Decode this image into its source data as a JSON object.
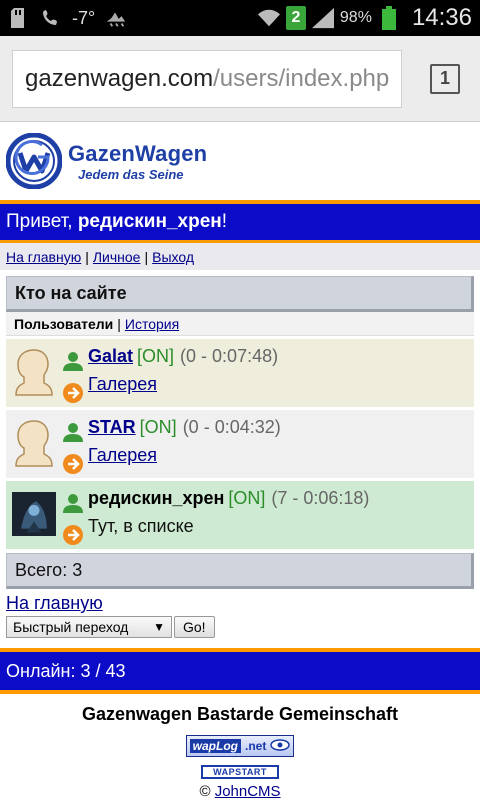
{
  "statusbar": {
    "temperature": "-7°",
    "notification_count": "2",
    "battery_percent": "98%",
    "time": "14:36"
  },
  "browser": {
    "url_host": "gazenwagen.com",
    "url_path": "/users/index.php",
    "tab_count": "1"
  },
  "site": {
    "name": "GazenWagen",
    "tagline": "Jedem das Seine"
  },
  "greeting": {
    "prefix": "Привет, ",
    "username": "редискин_хрен",
    "suffix": "!"
  },
  "topnav": {
    "home": "На главную",
    "personal": "Личное",
    "logout": "Выход"
  },
  "who_online": {
    "title": "Кто на сайте",
    "tab_users": "Пользователи",
    "tab_history": "История",
    "users": [
      {
        "name": "Galat",
        "status": "[ON]",
        "stat": "(0 - 0:07:48)",
        "location": "Галерея"
      },
      {
        "name": "STAR",
        "status": "[ON]",
        "stat": "(0 - 0:04:32)",
        "location": "Галерея"
      },
      {
        "name": "редискин_хрен",
        "status": "[ON]",
        "stat": "(7 - 0:06:18)",
        "location": "Тут, в списке"
      }
    ],
    "total": "Всего: 3"
  },
  "bottom": {
    "home_link": "На главную",
    "quick_nav": "Быстрый переход",
    "go_button": "Go!",
    "online": "Онлайн: 3 / 43",
    "footer_title": "Gazenwagen Bastarde Gemeinschaft",
    "waplog_left": "wapLog",
    "waplog_right": ".net",
    "wapstart": "WAPSTART",
    "copyright_prefix": "© ",
    "copyright_link": "JohnCMS"
  },
  "colors": {
    "header_blue": "#0b0bc8",
    "accent_orange": "#ff9a00",
    "link": "#00008b",
    "online_green": "#2a8d2a"
  }
}
